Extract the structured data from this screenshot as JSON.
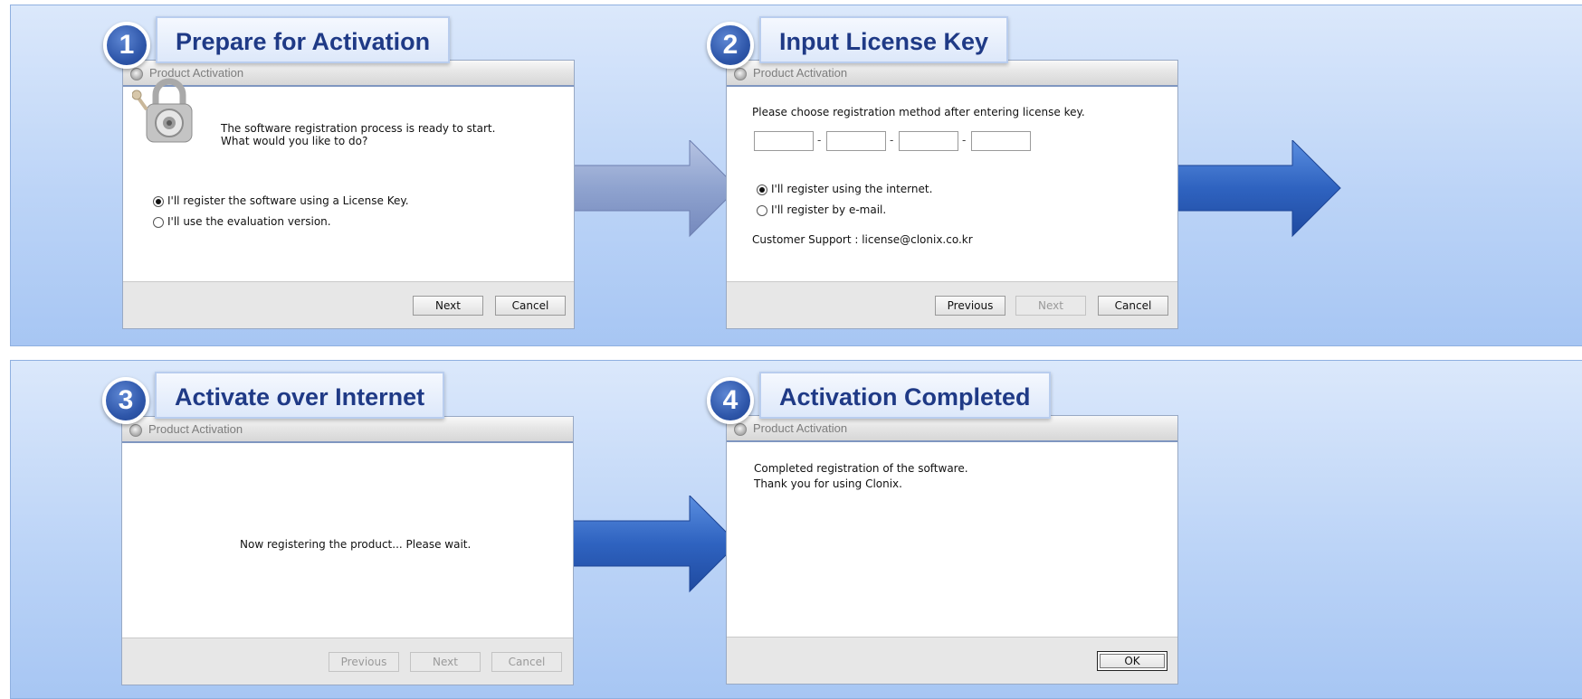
{
  "dialog_title": "Product Activation",
  "steps": [
    {
      "number": "1",
      "title": "Prepare for Activation",
      "message_line1": "The software registration process is ready to start.",
      "message_line2": "What would you like to do?",
      "option_license": "I'll register the software using a License Key.",
      "option_eval": "I'll use the evaluation version.",
      "selected_option": "license",
      "buttons": {
        "next": "Next",
        "cancel": "Cancel"
      }
    },
    {
      "number": "2",
      "title": "Input License Key",
      "instruction": "Please choose registration method after entering license key.",
      "key_separator": "-",
      "key_fields": [
        "",
        "",
        "",
        ""
      ],
      "option_internet": "I'll register using the internet.",
      "option_email": "I'll register by e-mail.",
      "selected_option": "internet",
      "support": "Customer Support : license@clonix.co.kr",
      "buttons": {
        "previous": "Previous",
        "next": "Next",
        "cancel": "Cancel"
      }
    },
    {
      "number": "3",
      "title": "Activate over Internet",
      "status": "Now registering the product... Please wait.",
      "buttons": {
        "previous": "Previous",
        "next": "Next",
        "cancel": "Cancel"
      }
    },
    {
      "number": "4",
      "title": "Activation Completed",
      "message_line1": "Completed registration of the software.",
      "message_line2": "Thank you for using Clonix.",
      "buttons": {
        "ok": "OK"
      }
    }
  ],
  "colors": {
    "panel_bg": "#c2d8f7",
    "badge": "#2f57aa",
    "title_text": "#1f3a86",
    "arrow_pale": "#8fa3cf",
    "arrow_blue": "#2f63c0"
  }
}
